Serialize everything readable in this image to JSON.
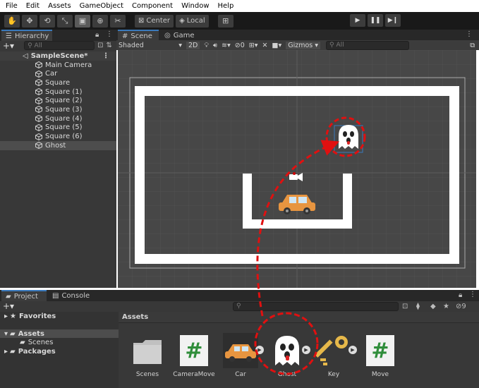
{
  "menu": [
    "File",
    "Edit",
    "Assets",
    "GameObject",
    "Component",
    "Window",
    "Help"
  ],
  "toolbar": {
    "center_label": "Center",
    "local_label": "Local"
  },
  "hierarchy": {
    "tab_label": "Hierarchy",
    "search_placeholder": "All",
    "scene_name": "SampleScene*",
    "items": [
      "Main Camera",
      "Car",
      "Square",
      "Square (1)",
      "Square (2)",
      "Square (3)",
      "Square (4)",
      "Square (5)",
      "Square (6)",
      "Ghost"
    ],
    "selected": "Ghost"
  },
  "scene_view": {
    "tabs": [
      "Scene",
      "Game"
    ],
    "shading": "Shaded",
    "mode_2d": "2D",
    "hidden_count": "0",
    "gizmos_label": "Gizmos",
    "search_placeholder": "All"
  },
  "project": {
    "tabs": [
      "Project",
      "Console"
    ],
    "favorites_label": "Favorites",
    "tree": [
      "Assets",
      "Scenes",
      "Packages"
    ],
    "breadcrumb": "Assets",
    "hidden_count": "9",
    "assets": [
      "Scenes",
      "CameraMove",
      "Car",
      "Ghost",
      "Key",
      "Move"
    ]
  },
  "colors": {
    "highlight": "#e01010",
    "selection": "#3a79bb",
    "panel": "#383838",
    "scene_bg": "#474747"
  }
}
